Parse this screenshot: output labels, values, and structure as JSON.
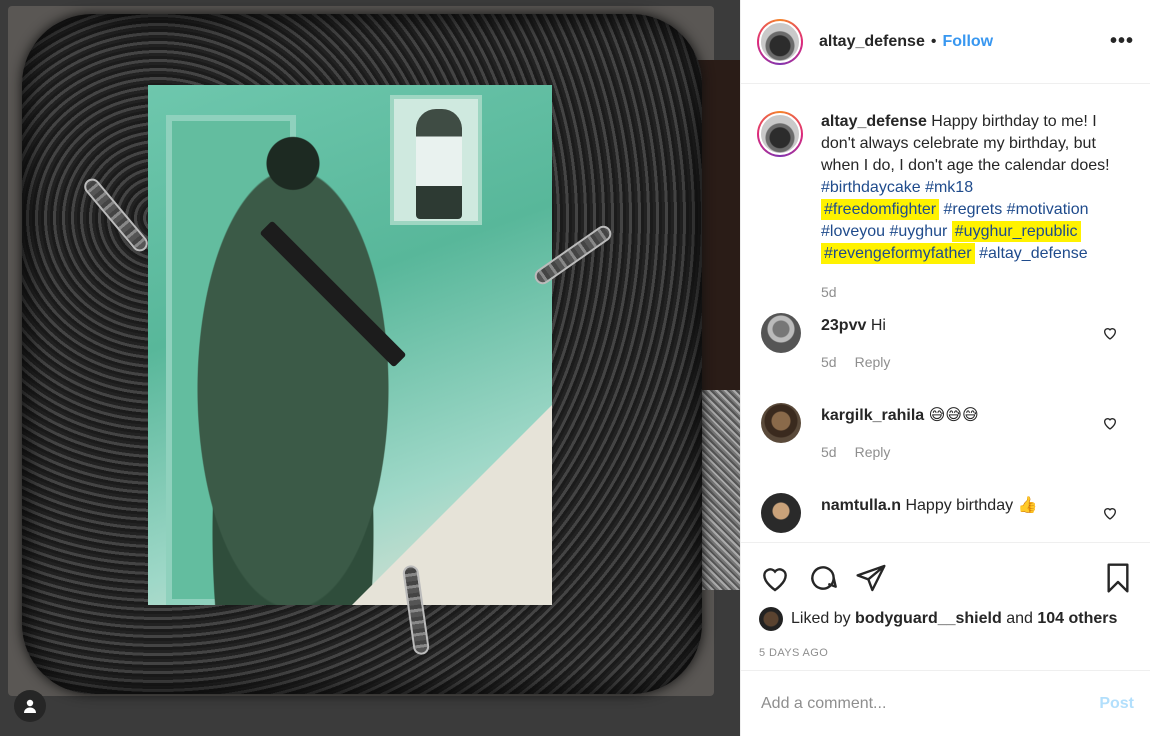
{
  "post": {
    "username": "altay_defense",
    "separator": "•",
    "follow_label": "Follow",
    "more_label": "•••"
  },
  "caption": {
    "username": "altay_defense",
    "text": "Happy birthday to me! I don't always celebrate my birthday, but when I do, I don't age the calendar does!",
    "hashtags": {
      "birthdaycake": "#birthdaycake",
      "mk18": "#mk18",
      "freedomfighter": "#freedomfighter",
      "regrets": "#regrets",
      "motivation": "#motivation",
      "loveyou": "#loveyou",
      "uyghur": "#uyghur",
      "uyghur_republic": "#uyghur_republic",
      "revengeformyfather": "#revengeformyfather",
      "altay_defense": "#altay_defense"
    },
    "highlight_color": "#fff200",
    "age": "5d"
  },
  "comments": [
    {
      "username": "23pvv",
      "text": "Hi",
      "age": "5d",
      "reply_label": "Reply"
    },
    {
      "username": "kargilk_rahila",
      "text": "😅😅😅",
      "age": "5d",
      "reply_label": "Reply"
    },
    {
      "username": "namtulla.n",
      "text": "Happy birthday 👍",
      "age": "",
      "reply_label": ""
    }
  ],
  "likes": {
    "prefix": "Liked by",
    "user": "bodyguard__shield",
    "and": "and",
    "others": "104 others"
  },
  "timestamp": "5 DAYS AGO",
  "add_comment": {
    "placeholder": "Add a comment...",
    "post_label": "Post"
  },
  "colors": {
    "link_blue": "#3897f0",
    "hashtag": "#1f4b8c",
    "muted": "#8e8e8e"
  },
  "icons": [
    "heart-icon",
    "comment-icon",
    "share-icon",
    "bookmark-icon",
    "user-tag-icon"
  ]
}
